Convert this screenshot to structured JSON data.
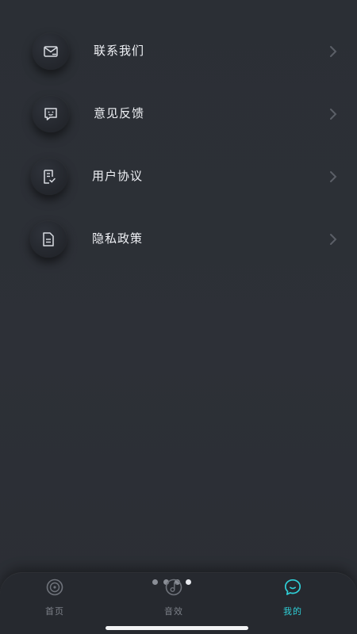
{
  "menu": {
    "items": [
      {
        "label": "联系我们",
        "icon": "mail-icon"
      },
      {
        "label": "意见反馈",
        "icon": "feedback-chat-icon"
      },
      {
        "label": "用户协议",
        "icon": "document-check-icon"
      },
      {
        "label": "隐私政策",
        "icon": "document-lines-icon"
      }
    ],
    "chevron_icon": "chevron-right-icon"
  },
  "pager": {
    "count": 4,
    "active_index": 3
  },
  "tabbar": {
    "tabs": [
      {
        "label": "首页",
        "icon": "disc-icon",
        "active": false
      },
      {
        "label": "音效",
        "icon": "music-note-icon",
        "active": false
      },
      {
        "label": "我的",
        "icon": "chat-bubble-smile-icon",
        "active": true
      }
    ]
  },
  "colors": {
    "background": "#2c2f36",
    "tabbar_background": "#26292f",
    "accent": "#2fd0d8",
    "text_primary": "#f0f2f6",
    "text_muted": "#7d8189"
  }
}
